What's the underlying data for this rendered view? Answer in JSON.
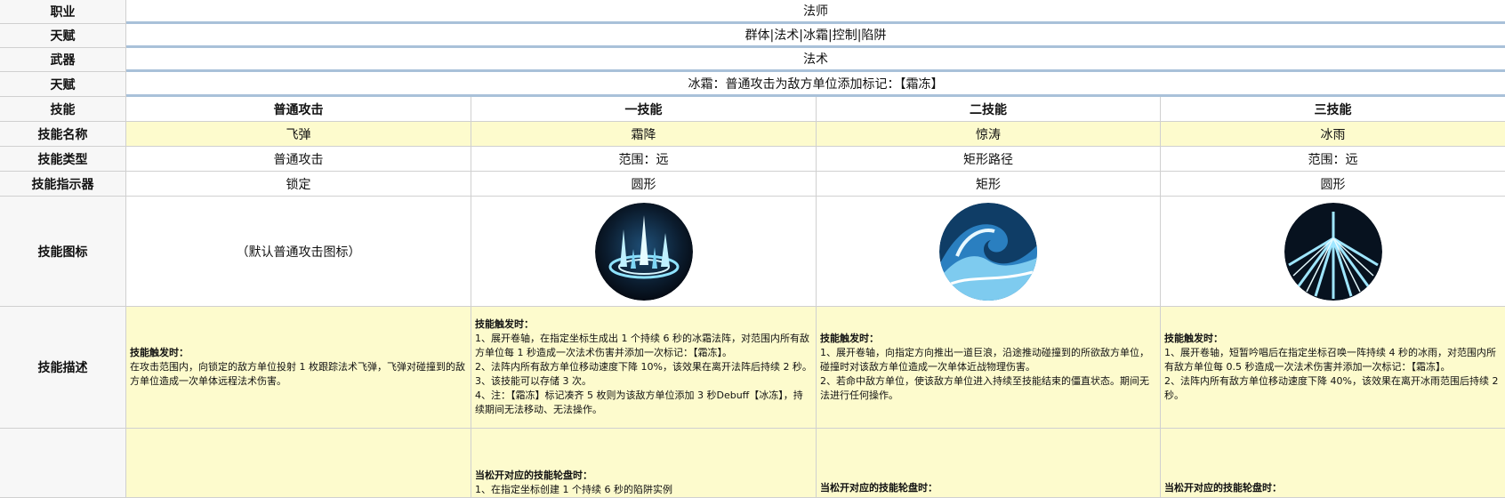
{
  "rows": {
    "class": {
      "label": "职业",
      "value": "法师"
    },
    "talent_tags": {
      "label": "天赋",
      "value": "群体|法术|冰霜|控制|陷阱"
    },
    "weapon": {
      "label": "武器",
      "value": "法术"
    },
    "talent": {
      "label": "天赋",
      "value": "冰霜：普通攻击为敌方单位添加标记：【霜冻】"
    },
    "skill_header": {
      "label": "技能",
      "cols": [
        "普通攻击",
        "一技能",
        "二技能",
        "三技能"
      ]
    },
    "skill_name": {
      "label": "技能名称",
      "cols": [
        "飞弹",
        "霜降",
        "惊涛",
        "冰雨"
      ]
    },
    "skill_type": {
      "label": "技能类型",
      "cols": [
        "普通攻击",
        "范围：远",
        "矩形路径",
        "范围：远"
      ]
    },
    "skill_indicator": {
      "label": "技能指示器",
      "cols": [
        "锁定",
        "圆形",
        "矩形",
        "圆形"
      ]
    },
    "skill_icon": {
      "label": "技能图标",
      "default_text": "（默认普通攻击图标）",
      "icons": [
        "frost-circle-icon",
        "wave-icon",
        "ice-rain-icon"
      ]
    },
    "skill_desc": {
      "label": "技能描述",
      "cols": [
        {
          "head": "技能触发时：",
          "lines": [
            "在攻击范围内，向锁定的敌方单位投射 1 枚跟踪法术飞弹，飞弹对碰撞到的敌方单位造成一次单体远程法术伤害。"
          ]
        },
        {
          "head": "技能触发时：",
          "lines": [
            "1、展开卷轴，在指定坐标生成出 1 个持续 6 秒的冰霜法阵，对范围内所有敌方单位每 1 秒造成一次法术伤害并添加一次标记：【霜冻】。",
            "2、法阵内所有敌方单位移动速度下降 10%，该效果在离开法阵后持续 2 秒。",
            "3、该技能可以存储 3 次。",
            "4、注：【霜冻】标记凑齐 5 枚则为该敌方单位添加 3 秒Debuff【冰冻】，持续期间无法移动、无法操作。"
          ]
        },
        {
          "head": "技能触发时：",
          "lines": [
            "1、展开卷轴，向指定方向推出一道巨浪，沿途推动碰撞到的所欲敌方单位，碰撞时对该敌方单位造成一次单体近战物理伤害。",
            "2、若命中敌方单位，使该敌方单位进入持续至技能结束的僵直状态。期间无法进行任何操作。"
          ]
        },
        {
          "head": "技能触发时：",
          "lines": [
            "1、展开卷轴，短暂吟唱后在指定坐标召唤一阵持续 4 秒的冰雨，对范围内所有敌方单位每 0.5 秒造成一次法术伤害并添加一次标记：【霜冻】。",
            "2、法阵内所有敌方单位移动速度下降 40%，该效果在离开冰雨范围后持续 2 秒。"
          ]
        }
      ]
    },
    "skill_release": {
      "cols": [
        {
          "head": "",
          "lines": []
        },
        {
          "head": "当松开对应的技能轮盘时：",
          "lines": [
            "1、在指定坐标创建 1 个持续 6 秒的陷阱实例"
          ]
        },
        {
          "head": "当松开对应的技能轮盘时：",
          "lines": []
        },
        {
          "head": "当松开对应的技能轮盘时：",
          "lines": []
        }
      ]
    }
  },
  "colors": {
    "label_bg": "#f7f7f7",
    "highlight": "#fdfbcd",
    "accent_border": "#a9c1d9"
  }
}
